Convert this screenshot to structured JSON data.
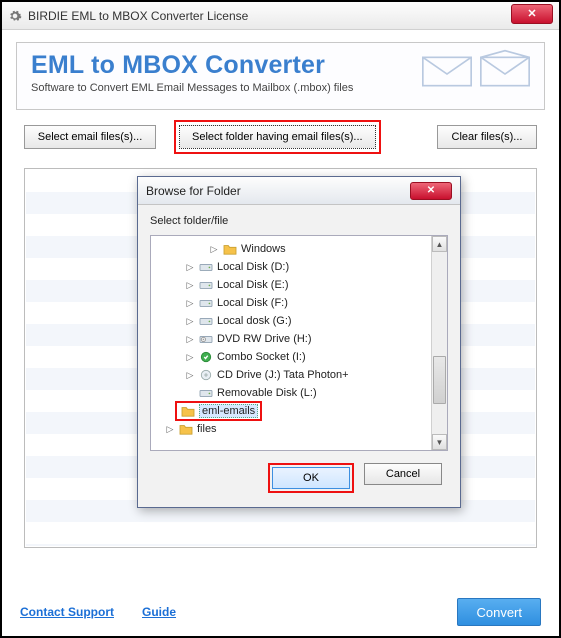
{
  "window": {
    "title": "BIRDIE EML to MBOX Converter License"
  },
  "banner": {
    "heading": "EML to MBOX Converter",
    "sub": "Software to Convert EML Email Messages to Mailbox (.mbox) files"
  },
  "toolbar": {
    "select_files": "Select email files(s)...",
    "select_folder": "Select folder having email files(s)...",
    "clear": "Clear files(s)..."
  },
  "dialog": {
    "title": "Browse for Folder",
    "label": "Select folder/file",
    "ok": "OK",
    "cancel": "Cancel",
    "tree": [
      {
        "indent": "i1",
        "exp": "▷",
        "icon": "folder",
        "label": "Windows"
      },
      {
        "indent": "i2",
        "exp": "▷",
        "icon": "drive",
        "label": "Local Disk (D:)"
      },
      {
        "indent": "i2",
        "exp": "▷",
        "icon": "drive",
        "label": "Local Disk (E:)"
      },
      {
        "indent": "i2",
        "exp": "▷",
        "icon": "drive",
        "label": "Local Disk (F:)"
      },
      {
        "indent": "i2",
        "exp": "▷",
        "icon": "drive",
        "label": "Local dosk  (G:)"
      },
      {
        "indent": "i2",
        "exp": "▷",
        "icon": "dvd",
        "label": "DVD RW Drive (H:)"
      },
      {
        "indent": "i2",
        "exp": "▷",
        "icon": "usb",
        "label": "Combo Socket (I:)"
      },
      {
        "indent": "i2",
        "exp": "▷",
        "icon": "cd",
        "label": "CD Drive (J:) Tata Photon+"
      },
      {
        "indent": "i2",
        "exp": "",
        "icon": "drive",
        "label": "Removable Disk (L:)"
      },
      {
        "indent": "i3",
        "exp": "",
        "icon": "folder",
        "label": "eml-emails",
        "selected": true
      },
      {
        "indent": "i3",
        "exp": "▷",
        "icon": "folder",
        "label": "files"
      }
    ]
  },
  "footer": {
    "support": "Contact Support",
    "guide": "Guide",
    "convert": "Convert"
  }
}
